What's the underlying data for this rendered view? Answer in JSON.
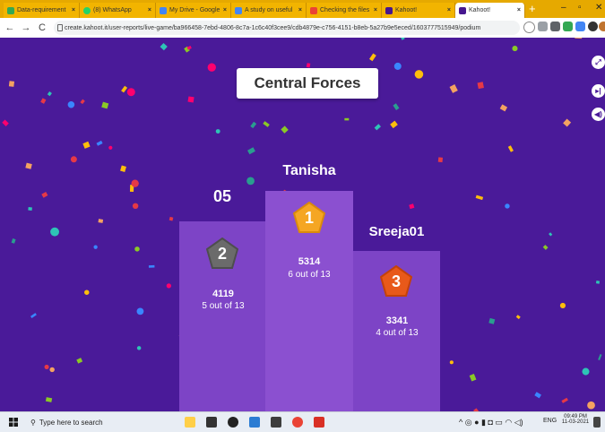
{
  "browser": {
    "tabs": [
      {
        "label": "Data-requirement",
        "color": "#34a853"
      },
      {
        "label": "(8) WhatsApp",
        "color": "#25d366"
      },
      {
        "label": "My Drive - Google",
        "color": "#4285f4"
      },
      {
        "label": "A study on useful",
        "color": "#4285f4"
      },
      {
        "label": "Checking the files",
        "color": "#ea4335"
      },
      {
        "label": "Kahoot!",
        "color": "#46178f"
      },
      {
        "label": "Kahoot!",
        "color": "#46178f"
      }
    ],
    "new_tab": "+",
    "url": "create.kahoot.it/user-reports/live-game/ba966458-7ebd-4806-8c7a-1c6c40f3cee9/cdb4879e-c756-4151-b8eb-5a27b9e5eced/1603777515949/podium"
  },
  "quiz": {
    "title": "Central Forces"
  },
  "podium": {
    "first": {
      "name": "Tanisha",
      "rank": "1",
      "score": "5314",
      "correct": "6 out of 13",
      "color": "#f5a623"
    },
    "second": {
      "name": "05",
      "rank": "2",
      "score": "4119",
      "correct": "5 out of 13",
      "color": "#6b6b6b"
    },
    "third": {
      "name": "Sreeja01",
      "rank": "3",
      "score": "3341",
      "correct": "4 out of 13",
      "color": "#e8591a"
    }
  },
  "taskbar": {
    "search_placeholder": "Type here to search",
    "language": "ENG",
    "time": "09:49 PM",
    "date": "11-03-2021"
  }
}
